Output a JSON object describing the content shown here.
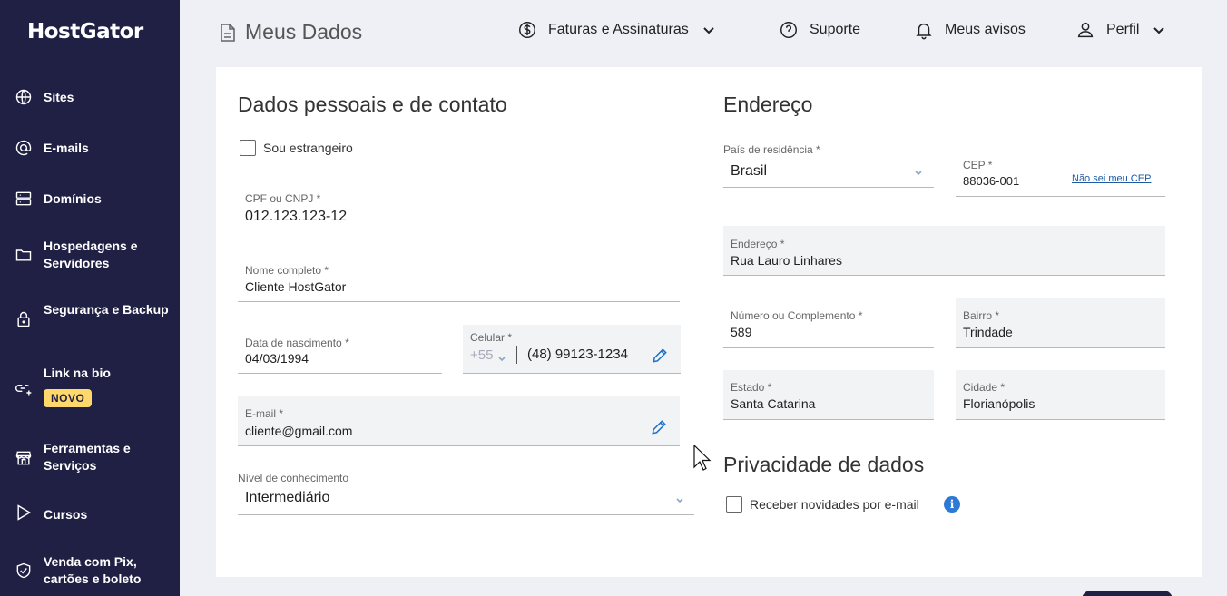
{
  "brand": {
    "name": "HostGator"
  },
  "sidebar": {
    "items": [
      {
        "label": "Sites",
        "icon": "globe-icon"
      },
      {
        "label": "E-mails",
        "icon": "at-icon"
      },
      {
        "label": "Domínios",
        "icon": "server-icon"
      },
      {
        "label": "Hospedagens e Servidores",
        "icon": "folder-icon"
      },
      {
        "label": "Segurança e Backup",
        "icon": "lock-icon"
      },
      {
        "label": "Link na bio",
        "icon": "link-plus-icon",
        "badge": "NOVO"
      },
      {
        "label": "Ferramentas e Serviços",
        "icon": "store-icon"
      },
      {
        "label": "Cursos",
        "icon": "play-icon"
      },
      {
        "label": "Venda com Pix, cartões e boleto",
        "icon": "shield-check-icon"
      }
    ]
  },
  "header": {
    "title": "Meus Dados",
    "links": {
      "billing": "Faturas e Assinaturas",
      "support": "Suporte",
      "notices": "Meus avisos",
      "profile": "Perfil"
    }
  },
  "personal": {
    "title": "Dados pessoais e de contato",
    "foreigner_label": "Sou estrangeiro",
    "cpf": {
      "label": "CPF ou CNPJ *",
      "value": "012.123.123-12"
    },
    "name": {
      "label": "Nome completo *",
      "value": "Cliente HostGator"
    },
    "birth": {
      "label": "Data de nascimento *",
      "value": "04/03/1994"
    },
    "phone": {
      "label": "Celular *",
      "ddi": "+55",
      "value": "(48) 99123-1234"
    },
    "email": {
      "label": "E-mail *",
      "value": "cliente@gmail.com"
    },
    "knowledge": {
      "label": "Nível de conhecimento",
      "value": "Intermediário"
    }
  },
  "address": {
    "title": "Endereço",
    "country": {
      "label": "País de residência *",
      "value": "Brasil"
    },
    "cep": {
      "label": "CEP *",
      "value": "88036-001",
      "link": "Não sei meu CEP"
    },
    "street": {
      "label": "Endereço *",
      "value": "Rua Lauro Linhares"
    },
    "number": {
      "label": "Número ou Complemento *",
      "value": "589"
    },
    "district": {
      "label": "Bairro *",
      "value": "Trindade"
    },
    "state": {
      "label": "Estado *",
      "value": "Santa Catarina"
    },
    "city": {
      "label": "Cidade *",
      "value": "Florianópolis"
    }
  },
  "privacy": {
    "title": "Privacidade de dados",
    "newsletter_label": "Receber novidades por e-mail"
  },
  "colors": {
    "sidebar_bg": "#1f2044",
    "accent_blue": "#1c6fc9",
    "badge_yellow": "#ffd86b"
  }
}
